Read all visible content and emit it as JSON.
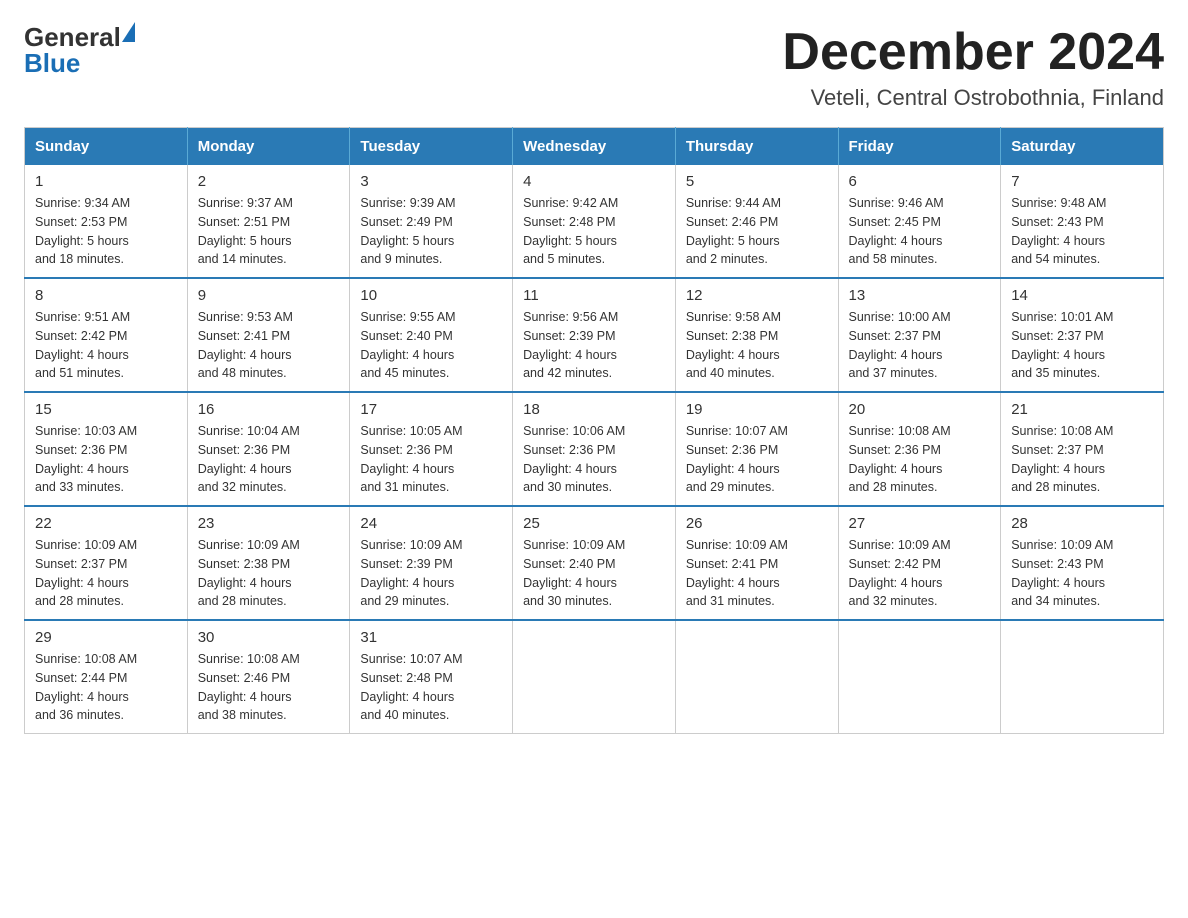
{
  "logo": {
    "text_general": "General",
    "text_blue": "Blue",
    "aria": "GeneralBlue logo"
  },
  "header": {
    "month_year": "December 2024",
    "location": "Veteli, Central Ostrobothnia, Finland"
  },
  "days_of_week": [
    "Sunday",
    "Monday",
    "Tuesday",
    "Wednesday",
    "Thursday",
    "Friday",
    "Saturday"
  ],
  "weeks": [
    [
      {
        "day": "1",
        "sunrise": "9:34 AM",
        "sunset": "2:53 PM",
        "daylight": "5 hours and 18 minutes."
      },
      {
        "day": "2",
        "sunrise": "9:37 AM",
        "sunset": "2:51 PM",
        "daylight": "5 hours and 14 minutes."
      },
      {
        "day": "3",
        "sunrise": "9:39 AM",
        "sunset": "2:49 PM",
        "daylight": "5 hours and 9 minutes."
      },
      {
        "day": "4",
        "sunrise": "9:42 AM",
        "sunset": "2:48 PM",
        "daylight": "5 hours and 5 minutes."
      },
      {
        "day": "5",
        "sunrise": "9:44 AM",
        "sunset": "2:46 PM",
        "daylight": "5 hours and 2 minutes."
      },
      {
        "day": "6",
        "sunrise": "9:46 AM",
        "sunset": "2:45 PM",
        "daylight": "4 hours and 58 minutes."
      },
      {
        "day": "7",
        "sunrise": "9:48 AM",
        "sunset": "2:43 PM",
        "daylight": "4 hours and 54 minutes."
      }
    ],
    [
      {
        "day": "8",
        "sunrise": "9:51 AM",
        "sunset": "2:42 PM",
        "daylight": "4 hours and 51 minutes."
      },
      {
        "day": "9",
        "sunrise": "9:53 AM",
        "sunset": "2:41 PM",
        "daylight": "4 hours and 48 minutes."
      },
      {
        "day": "10",
        "sunrise": "9:55 AM",
        "sunset": "2:40 PM",
        "daylight": "4 hours and 45 minutes."
      },
      {
        "day": "11",
        "sunrise": "9:56 AM",
        "sunset": "2:39 PM",
        "daylight": "4 hours and 42 minutes."
      },
      {
        "day": "12",
        "sunrise": "9:58 AM",
        "sunset": "2:38 PM",
        "daylight": "4 hours and 40 minutes."
      },
      {
        "day": "13",
        "sunrise": "10:00 AM",
        "sunset": "2:37 PM",
        "daylight": "4 hours and 37 minutes."
      },
      {
        "day": "14",
        "sunrise": "10:01 AM",
        "sunset": "2:37 PM",
        "daylight": "4 hours and 35 minutes."
      }
    ],
    [
      {
        "day": "15",
        "sunrise": "10:03 AM",
        "sunset": "2:36 PM",
        "daylight": "4 hours and 33 minutes."
      },
      {
        "day": "16",
        "sunrise": "10:04 AM",
        "sunset": "2:36 PM",
        "daylight": "4 hours and 32 minutes."
      },
      {
        "day": "17",
        "sunrise": "10:05 AM",
        "sunset": "2:36 PM",
        "daylight": "4 hours and 31 minutes."
      },
      {
        "day": "18",
        "sunrise": "10:06 AM",
        "sunset": "2:36 PM",
        "daylight": "4 hours and 30 minutes."
      },
      {
        "day": "19",
        "sunrise": "10:07 AM",
        "sunset": "2:36 PM",
        "daylight": "4 hours and 29 minutes."
      },
      {
        "day": "20",
        "sunrise": "10:08 AM",
        "sunset": "2:36 PM",
        "daylight": "4 hours and 28 minutes."
      },
      {
        "day": "21",
        "sunrise": "10:08 AM",
        "sunset": "2:37 PM",
        "daylight": "4 hours and 28 minutes."
      }
    ],
    [
      {
        "day": "22",
        "sunrise": "10:09 AM",
        "sunset": "2:37 PM",
        "daylight": "4 hours and 28 minutes."
      },
      {
        "day": "23",
        "sunrise": "10:09 AM",
        "sunset": "2:38 PM",
        "daylight": "4 hours and 28 minutes."
      },
      {
        "day": "24",
        "sunrise": "10:09 AM",
        "sunset": "2:39 PM",
        "daylight": "4 hours and 29 minutes."
      },
      {
        "day": "25",
        "sunrise": "10:09 AM",
        "sunset": "2:40 PM",
        "daylight": "4 hours and 30 minutes."
      },
      {
        "day": "26",
        "sunrise": "10:09 AM",
        "sunset": "2:41 PM",
        "daylight": "4 hours and 31 minutes."
      },
      {
        "day": "27",
        "sunrise": "10:09 AM",
        "sunset": "2:42 PM",
        "daylight": "4 hours and 32 minutes."
      },
      {
        "day": "28",
        "sunrise": "10:09 AM",
        "sunset": "2:43 PM",
        "daylight": "4 hours and 34 minutes."
      }
    ],
    [
      {
        "day": "29",
        "sunrise": "10:08 AM",
        "sunset": "2:44 PM",
        "daylight": "4 hours and 36 minutes."
      },
      {
        "day": "30",
        "sunrise": "10:08 AM",
        "sunset": "2:46 PM",
        "daylight": "4 hours and 38 minutes."
      },
      {
        "day": "31",
        "sunrise": "10:07 AM",
        "sunset": "2:48 PM",
        "daylight": "4 hours and 40 minutes."
      },
      null,
      null,
      null,
      null
    ]
  ]
}
